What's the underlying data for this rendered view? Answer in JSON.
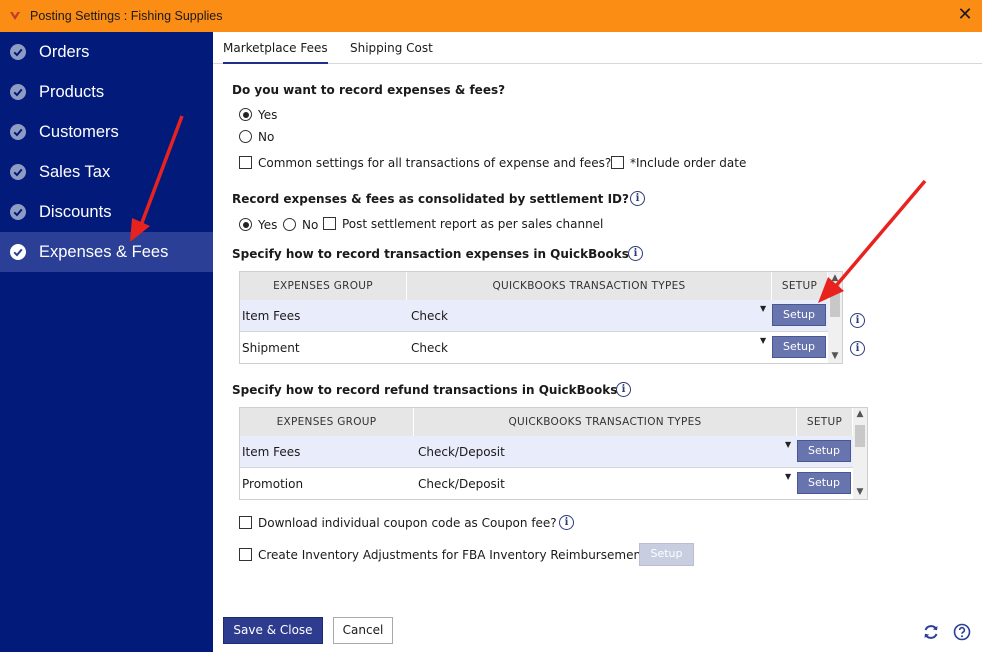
{
  "window": {
    "title": "Posting Settings : Fishing Supplies",
    "close_glyph": "✕",
    "accent_color": "#fb8c14"
  },
  "sidebar": {
    "bg_color": "#021a7a",
    "items": [
      {
        "label": "Orders",
        "active": false
      },
      {
        "label": "Products",
        "active": false
      },
      {
        "label": "Customers",
        "active": false
      },
      {
        "label": "Sales Tax",
        "active": false
      },
      {
        "label": "Discounts",
        "active": false
      },
      {
        "label": "Expenses & Fees",
        "active": true
      }
    ]
  },
  "tabs": [
    {
      "label": "Marketplace Fees",
      "active": true
    },
    {
      "label": "Shipping Cost",
      "active": false
    }
  ],
  "record_expenses": {
    "question": "Do you want to record expenses & fees?",
    "yes_label": "Yes",
    "no_label": "No",
    "selected": "Yes",
    "common_settings_label": "Common settings for all transactions of expense and fees?",
    "common_settings_checked": false,
    "include_order_date_label": "*Include order date",
    "include_order_date_checked": false
  },
  "consolidated": {
    "question": "Record expenses & fees as consolidated by settlement ID?",
    "yes_label": "Yes",
    "no_label": "No",
    "selected": "Yes",
    "post_settlement_label": "Post settlement report as per sales channel",
    "post_settlement_checked": false
  },
  "expenses_table": {
    "heading": "Specify how to record transaction expenses in QuickBooks",
    "columns": [
      "EXPENSES GROUP",
      "QUICKBOOKS TRANSACTION TYPES",
      "SETUP"
    ],
    "rows": [
      {
        "group": "Item Fees",
        "type": "Check",
        "setup": "Setup"
      },
      {
        "group": "Shipment",
        "type": "Check",
        "setup": "Setup"
      }
    ]
  },
  "refund_table": {
    "heading": "Specify how to record refund transactions in QuickBooks",
    "columns": [
      "EXPENSES GROUP",
      "QUICKBOOKS TRANSACTION TYPES",
      "SETUP"
    ],
    "rows": [
      {
        "group": "Item Fees",
        "type": "Check/Deposit",
        "setup": "Setup"
      },
      {
        "group": "Promotion",
        "type": "Check/Deposit",
        "setup": "Setup"
      }
    ]
  },
  "options": {
    "coupon_label": "Download individual coupon code as Coupon fee?",
    "coupon_checked": false,
    "fba_label": "Create Inventory Adjustments for FBA Inventory Reimbursement",
    "fba_checked": false,
    "fba_setup": "Setup"
  },
  "footer": {
    "save_label": "Save & Close",
    "cancel_label": "Cancel"
  },
  "icons": {
    "info": "info-icon",
    "refresh": "refresh-icon",
    "help": "help-icon"
  }
}
